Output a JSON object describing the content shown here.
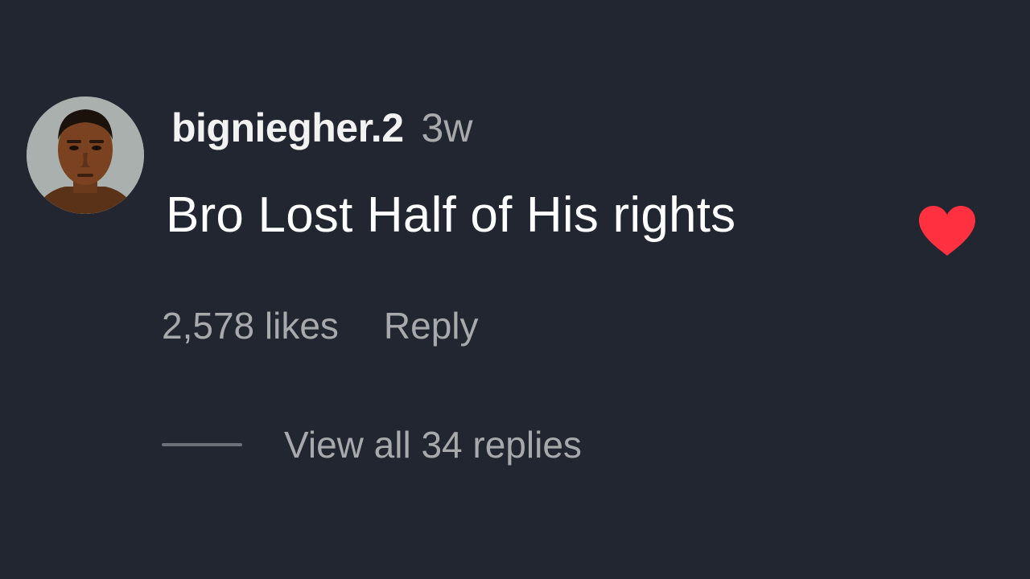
{
  "comment": {
    "username": "bigniegher.2",
    "timestamp": "3w",
    "text": "Bro Lost Half of His rights",
    "liked": true,
    "likes_label": "2,578 likes",
    "reply_label": "Reply",
    "view_replies_label": "View all 34 replies"
  },
  "icons": {
    "avatar": "profile-avatar",
    "like": "heart-icon"
  },
  "colors": {
    "background": "#212630",
    "username": "#f2f2f2",
    "muted_text": "#a7a9ad",
    "comment_text": "#ffffff",
    "heart": "#ff3040",
    "divider": "#6c7078"
  }
}
